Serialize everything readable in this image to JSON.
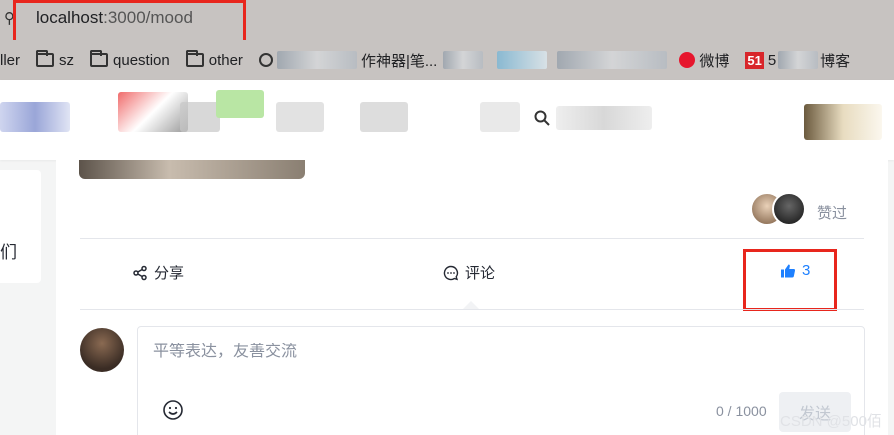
{
  "browser": {
    "site_info_icon": "site-info-icon",
    "url_host": "localhost",
    "url_rest": ":3000/mood",
    "bookmarks": [
      {
        "label": "ller",
        "icon": "none"
      },
      {
        "label": "sz",
        "icon": "folder-icon"
      },
      {
        "label": "question",
        "icon": "folder-icon"
      },
      {
        "label": "other",
        "icon": "folder-icon"
      },
      {
        "label": "作神器|笔...",
        "icon": "globe-icon"
      },
      {
        "label": "微博",
        "icon": "weibo-icon"
      },
      {
        "label": "5",
        "icon": "51-icon"
      },
      {
        "label": "博客",
        "icon": "none"
      }
    ],
    "badge_51": "51"
  },
  "header": {
    "search_icon": "search-icon"
  },
  "sidebar": {
    "partial_text": "们"
  },
  "post": {
    "liked_label": "赞过",
    "actions": {
      "share": "分享",
      "comment": "评论",
      "like_count": "3"
    },
    "colors": {
      "like_accent": "#1e80ff",
      "highlight": "#e8261d"
    }
  },
  "comment": {
    "placeholder": "平等表达，友善交流",
    "counter": "0 / 1000",
    "send": "发送"
  },
  "watermark": "CSDN @500佰"
}
